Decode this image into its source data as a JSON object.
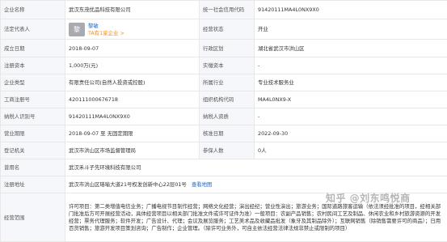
{
  "rows": {
    "company_name": {
      "label": "企业名称",
      "value": "武汉东茂优品科技有限公司"
    },
    "credit_code": {
      "label": "统一社会信用代码",
      "value": "91420111MA4L0NX9X0"
    },
    "legal_rep": {
      "label": "法定代表人",
      "avatar": "黎",
      "name": "黎敏",
      "sub": "TA有1家企业 >"
    },
    "status": {
      "label": "经营状态",
      "value": "开业"
    },
    "established": {
      "label": "成立日期",
      "value": "2018-09-07"
    },
    "region": {
      "label": "行政区划",
      "value": "湖北省武汉市洪山区"
    },
    "reg_capital": {
      "label": "注册资本",
      "value": "1,000万(元)"
    },
    "paid_capital": {
      "label": "实缴资本",
      "value": "-"
    },
    "company_type": {
      "label": "企业类型",
      "value": "有限责任公司(自然人投资或控股)"
    },
    "industry": {
      "label": "所属行业",
      "value": "专业技术服务业"
    },
    "reg_number": {
      "label": "工商注册号",
      "value": "420111000676718"
    },
    "org_code": {
      "label": "组织机构代码",
      "value": "MA4L0NX9-X"
    },
    "taxpayer_id": {
      "label": "纳税人识别号",
      "value": "91420111MA4L0NX9X0"
    },
    "taxpayer_qual": {
      "label": "纳税人资质",
      "value": "-"
    },
    "term": {
      "label": "营业期限",
      "value": "2018-09-07 至 无固定期限"
    },
    "approval_date": {
      "label": "核准日期",
      "value": "2022-09-30"
    },
    "authority": {
      "label": "登记机关",
      "value": "武汉市洪山区市场监督管理局"
    },
    "insured": {
      "label": "参保人数",
      "value": "0人"
    },
    "former_name": {
      "label": "曾用名",
      "value": "武汉禾斗子先环境科技有限公司"
    },
    "address": {
      "label": "注册地址",
      "value": "武汉市洪山区珞喻大道21号权发创新中心22层01号",
      "link": "查看地图"
    },
    "scope": {
      "label": "经营范围",
      "value": "许可项目：第二类增值电信业务；广播电视节目制作经营；网络文化经营；演出经纪；营业性演出；旅游业务；国际道路旅客运输（依法须经批准的项目，经相关部门批准后方可开展经营活动，具体经营项目以相关部门批准文件或许可证件为准）一般项目：农副产品销售；农村民间工艺及制品、休闲农业和乡村旅游资源的开发经营；票务代理服务；软件开发；广告设计、代理；会议及展览服务；工艺美术品及收藏品批发（象牙及其制品除外）；互联网销售（除销售需要许可的商品）；日用百货销售；旅游开发项目策划咨询；广告制作；企业管理。（除许可业务外，可自主依法经营法律法规非禁止或限制的项目）"
    }
  },
  "watermark": "知乎 @刘东鸣悦商"
}
